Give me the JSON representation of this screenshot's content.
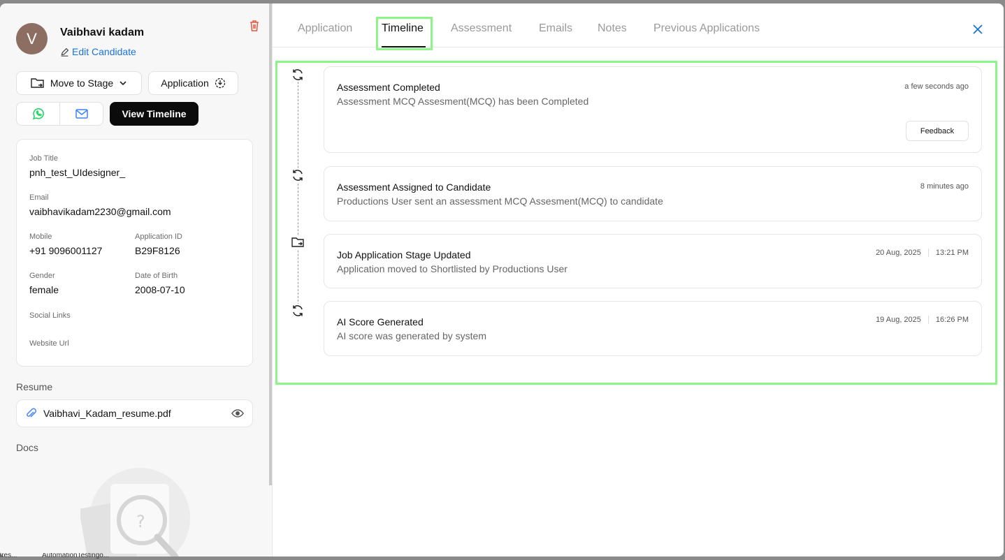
{
  "candidate": {
    "initial": "V",
    "name": "Vaibhavi kadam",
    "edit_label": "Edit Candidate"
  },
  "actions": {
    "move_to_stage": "Move to Stage",
    "application": "Application",
    "view_timeline": "View Timeline"
  },
  "info": {
    "job_title_label": "Job Title",
    "job_title": "pnh_test_UIdesigner_",
    "email_label": "Email",
    "email": "vaibhavikadam2230@gmail.com",
    "mobile_label": "Mobile",
    "mobile": "+91 9096001127",
    "app_id_label": "Application ID",
    "app_id": "B29F8126",
    "gender_label": "Gender",
    "gender": "female",
    "dob_label": "Date of Birth",
    "dob": "2008-07-10",
    "social_label": "Social Links",
    "website_label": "Website Url"
  },
  "resume": {
    "title": "Resume",
    "file": "Vaibhavi_Kadam_resume.pdf"
  },
  "docs": {
    "title": "Docs"
  },
  "tabs": [
    {
      "label": "Application"
    },
    {
      "label": "Timeline"
    },
    {
      "label": "Assessment"
    },
    {
      "label": "Emails"
    },
    {
      "label": "Notes"
    },
    {
      "label": "Previous Applications"
    }
  ],
  "timeline": [
    {
      "title": "Assessment Completed",
      "desc": "Assessment MCQ Assesment(MCQ) has been Completed",
      "time": "a few seconds ago",
      "action": "Feedback",
      "icon": "refresh-icon"
    },
    {
      "title": "Assessment Assigned to Candidate",
      "desc": "Productions User sent an assessment MCQ Assesment(MCQ) to candidate",
      "time": "8 minutes ago",
      "icon": "refresh-icon"
    },
    {
      "title": "Job Application Stage Updated",
      "desc": "Application moved to Shortlisted by Productions User",
      "date": "20 Aug, 2025",
      "hour": "13:21 PM",
      "icon": "folder-move-icon"
    },
    {
      "title": "AI Score Generated",
      "desc": "AI score was generated by system",
      "date": "19 Aug, 2025",
      "hour": "16:26 PM",
      "icon": "refresh-icon"
    }
  ],
  "taskbar": {
    "item1": "ires...",
    "item2": "AutomationTestingo..."
  },
  "colors": {
    "accent": "#1a73d9",
    "highlight": "#8cf58a",
    "danger": "#e8553e",
    "whatsapp": "#25d366",
    "mail": "#3b82f6"
  }
}
